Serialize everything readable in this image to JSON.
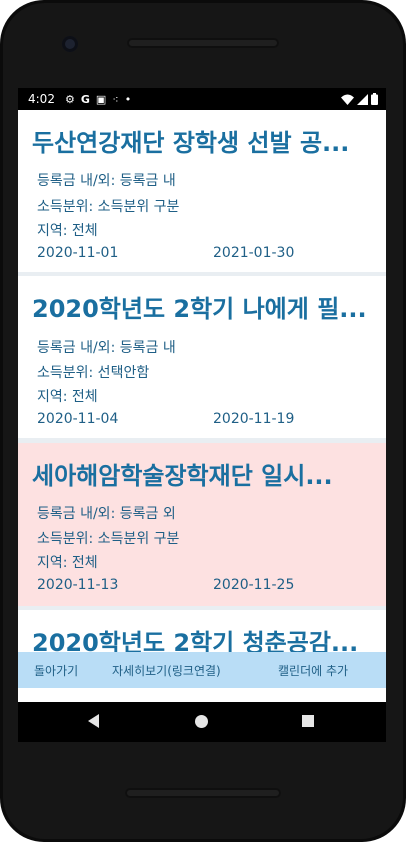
{
  "status": {
    "time": "4:02",
    "icons_left": [
      "gear-icon",
      "google-icon",
      "gallery-icon",
      "dots-icon",
      "dot-icon"
    ],
    "icons_right": [
      "wifi-icon",
      "signal-icon",
      "battery-icon"
    ]
  },
  "cards": [
    {
      "title": "두산연강재단 장학생 선발 공...",
      "line1": "등록금 내/외: 등록금 내",
      "line2": "소득분위: 소득분위 구분",
      "line3": "지역: 전체",
      "start": "2020-11-01",
      "end": "2021-01-30"
    },
    {
      "title": "2020학년도 2학기 나에게 필...",
      "line1": "등록금 내/외: 등록금 내",
      "line2": "소득분위: 선택안함",
      "line3": "지역: 전체",
      "start": "2020-11-04",
      "end": "2020-11-19"
    },
    {
      "title": "세아해암학술장학재단 일시...",
      "line1": "등록금 내/외: 등록금 외",
      "line2": "소득분위: 소득분위 구분",
      "line3": "지역: 전체",
      "start": "2020-11-13",
      "end": "2020-11-25"
    },
    {
      "title": "2020학년도 2학기 청춘공감..."
    }
  ],
  "bottom": {
    "back": "돌아가기",
    "detail": "자세히보기(링크연결)",
    "calendar": "캘린더에 추가"
  },
  "colors": {
    "accent": "#1a6fa0",
    "highlight": "#fde1e1",
    "bottom_bar": "#b9ddf6"
  }
}
